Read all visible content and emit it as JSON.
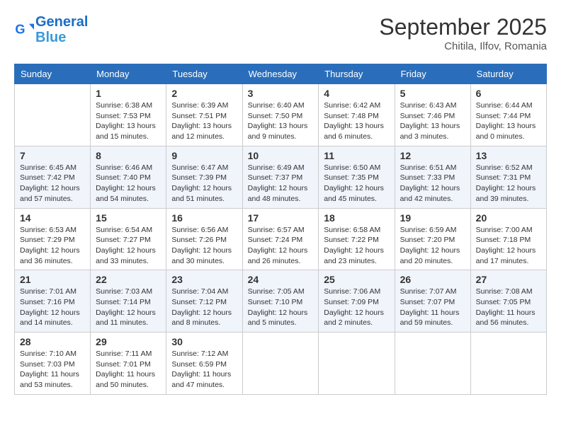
{
  "header": {
    "logo_line1": "General",
    "logo_line2": "Blue",
    "month": "September 2025",
    "location": "Chitila, Ilfov, Romania"
  },
  "days_of_week": [
    "Sunday",
    "Monday",
    "Tuesday",
    "Wednesday",
    "Thursday",
    "Friday",
    "Saturday"
  ],
  "weeks": [
    [
      {
        "day": "",
        "info": ""
      },
      {
        "day": "1",
        "info": "Sunrise: 6:38 AM\nSunset: 7:53 PM\nDaylight: 13 hours\nand 15 minutes."
      },
      {
        "day": "2",
        "info": "Sunrise: 6:39 AM\nSunset: 7:51 PM\nDaylight: 13 hours\nand 12 minutes."
      },
      {
        "day": "3",
        "info": "Sunrise: 6:40 AM\nSunset: 7:50 PM\nDaylight: 13 hours\nand 9 minutes."
      },
      {
        "day": "4",
        "info": "Sunrise: 6:42 AM\nSunset: 7:48 PM\nDaylight: 13 hours\nand 6 minutes."
      },
      {
        "day": "5",
        "info": "Sunrise: 6:43 AM\nSunset: 7:46 PM\nDaylight: 13 hours\nand 3 minutes."
      },
      {
        "day": "6",
        "info": "Sunrise: 6:44 AM\nSunset: 7:44 PM\nDaylight: 13 hours\nand 0 minutes."
      }
    ],
    [
      {
        "day": "7",
        "info": "Sunrise: 6:45 AM\nSunset: 7:42 PM\nDaylight: 12 hours\nand 57 minutes."
      },
      {
        "day": "8",
        "info": "Sunrise: 6:46 AM\nSunset: 7:40 PM\nDaylight: 12 hours\nand 54 minutes."
      },
      {
        "day": "9",
        "info": "Sunrise: 6:47 AM\nSunset: 7:39 PM\nDaylight: 12 hours\nand 51 minutes."
      },
      {
        "day": "10",
        "info": "Sunrise: 6:49 AM\nSunset: 7:37 PM\nDaylight: 12 hours\nand 48 minutes."
      },
      {
        "day": "11",
        "info": "Sunrise: 6:50 AM\nSunset: 7:35 PM\nDaylight: 12 hours\nand 45 minutes."
      },
      {
        "day": "12",
        "info": "Sunrise: 6:51 AM\nSunset: 7:33 PM\nDaylight: 12 hours\nand 42 minutes."
      },
      {
        "day": "13",
        "info": "Sunrise: 6:52 AM\nSunset: 7:31 PM\nDaylight: 12 hours\nand 39 minutes."
      }
    ],
    [
      {
        "day": "14",
        "info": "Sunrise: 6:53 AM\nSunset: 7:29 PM\nDaylight: 12 hours\nand 36 minutes."
      },
      {
        "day": "15",
        "info": "Sunrise: 6:54 AM\nSunset: 7:27 PM\nDaylight: 12 hours\nand 33 minutes."
      },
      {
        "day": "16",
        "info": "Sunrise: 6:56 AM\nSunset: 7:26 PM\nDaylight: 12 hours\nand 30 minutes."
      },
      {
        "day": "17",
        "info": "Sunrise: 6:57 AM\nSunset: 7:24 PM\nDaylight: 12 hours\nand 26 minutes."
      },
      {
        "day": "18",
        "info": "Sunrise: 6:58 AM\nSunset: 7:22 PM\nDaylight: 12 hours\nand 23 minutes."
      },
      {
        "day": "19",
        "info": "Sunrise: 6:59 AM\nSunset: 7:20 PM\nDaylight: 12 hours\nand 20 minutes."
      },
      {
        "day": "20",
        "info": "Sunrise: 7:00 AM\nSunset: 7:18 PM\nDaylight: 12 hours\nand 17 minutes."
      }
    ],
    [
      {
        "day": "21",
        "info": "Sunrise: 7:01 AM\nSunset: 7:16 PM\nDaylight: 12 hours\nand 14 minutes."
      },
      {
        "day": "22",
        "info": "Sunrise: 7:03 AM\nSunset: 7:14 PM\nDaylight: 12 hours\nand 11 minutes."
      },
      {
        "day": "23",
        "info": "Sunrise: 7:04 AM\nSunset: 7:12 PM\nDaylight: 12 hours\nand 8 minutes."
      },
      {
        "day": "24",
        "info": "Sunrise: 7:05 AM\nSunset: 7:10 PM\nDaylight: 12 hours\nand 5 minutes."
      },
      {
        "day": "25",
        "info": "Sunrise: 7:06 AM\nSunset: 7:09 PM\nDaylight: 12 hours\nand 2 minutes."
      },
      {
        "day": "26",
        "info": "Sunrise: 7:07 AM\nSunset: 7:07 PM\nDaylight: 11 hours\nand 59 minutes."
      },
      {
        "day": "27",
        "info": "Sunrise: 7:08 AM\nSunset: 7:05 PM\nDaylight: 11 hours\nand 56 minutes."
      }
    ],
    [
      {
        "day": "28",
        "info": "Sunrise: 7:10 AM\nSunset: 7:03 PM\nDaylight: 11 hours\nand 53 minutes."
      },
      {
        "day": "29",
        "info": "Sunrise: 7:11 AM\nSunset: 7:01 PM\nDaylight: 11 hours\nand 50 minutes."
      },
      {
        "day": "30",
        "info": "Sunrise: 7:12 AM\nSunset: 6:59 PM\nDaylight: 11 hours\nand 47 minutes."
      },
      {
        "day": "",
        "info": ""
      },
      {
        "day": "",
        "info": ""
      },
      {
        "day": "",
        "info": ""
      },
      {
        "day": "",
        "info": ""
      }
    ]
  ]
}
